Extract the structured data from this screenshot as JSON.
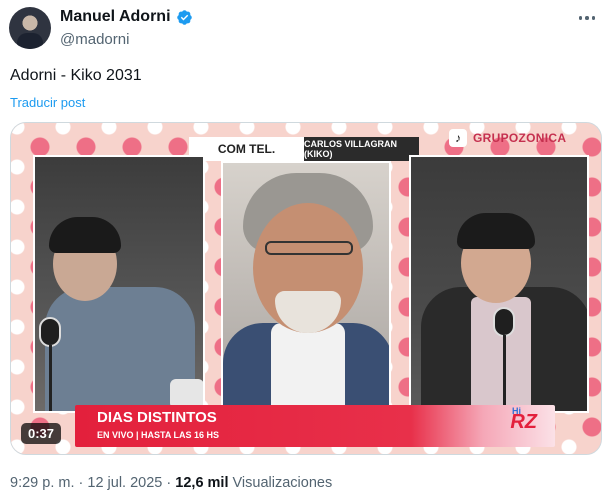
{
  "author": {
    "display_name": "Manuel Adorni",
    "handle": "@madorni",
    "verified_icon": "verified-badge-icon",
    "verified_color": "#1d9bf0"
  },
  "post": {
    "text": "Adorni - Kiko 2031",
    "translate_label": "Traducir post"
  },
  "video": {
    "duration": "0:37",
    "banner_left": "COM TEL.",
    "banner_right": "CARLOS VILLAGRAN (KIKO)",
    "brand": "GRUPOZONICA",
    "lower_title": "DIAS DISTINTOS",
    "lower_subtitle": "EN VIVO | HASTA LAS 16 HS",
    "lower_logo_top": "Hi",
    "lower_logo": "RZ"
  },
  "footer": {
    "time": "9:29 p. m.",
    "separator": "·",
    "date": "12 jul. 2025",
    "views_count": "12,6 mil",
    "views_label": "Visualizaciones"
  },
  "colors": {
    "text_primary": "#0f1419",
    "text_secondary": "#536471",
    "link": "#1d9bf0",
    "banner_red": "#e3203c",
    "polka_pink": "#ee6f86"
  }
}
